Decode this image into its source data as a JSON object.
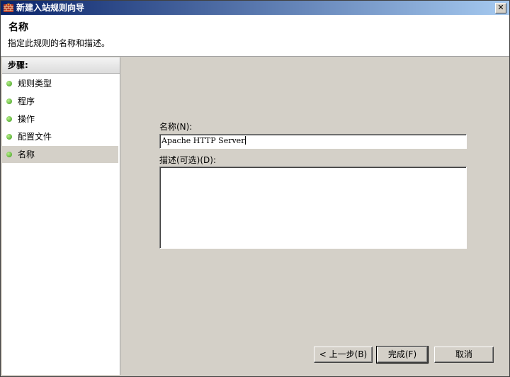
{
  "window": {
    "title": "新建入站规则向导",
    "close_symbol": "✕"
  },
  "header": {
    "title": "名称",
    "description": "指定此规则的名称和描述。"
  },
  "sidebar": {
    "heading": "步骤:",
    "steps": [
      {
        "label": "规则类型"
      },
      {
        "label": "程序"
      },
      {
        "label": "操作"
      },
      {
        "label": "配置文件"
      },
      {
        "label": "名称"
      }
    ],
    "active_step": "名称"
  },
  "form": {
    "name_label": "名称(N):",
    "name_value": "Apache HTTP Server",
    "description_label": "描述(可选)(D):",
    "description_value": ""
  },
  "buttons": {
    "back": "< 上一步(B)",
    "finish": "完成(F)",
    "cancel": "取消"
  },
  "colors": {
    "step_dot": "#3a9a1a",
    "titlebar": "#0a246a"
  }
}
